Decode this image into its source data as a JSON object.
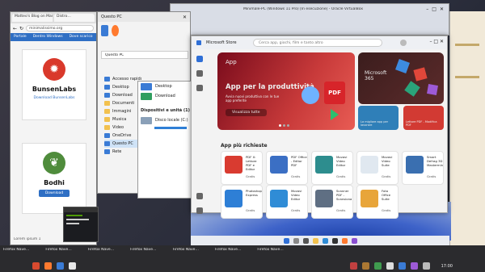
{
  "top_window": {
    "title": "Minimale-PC (Windows 11 Pro) [In esecuzione] - Oracle VirtualBox"
  },
  "browser": {
    "tab1": "Matteo's Blog on Mastodon",
    "tab2": "Distro…",
    "url": "minimalissimo.org",
    "nav": [
      "Portale",
      "Dentro Windows",
      "Dove scarico"
    ],
    "distros": [
      {
        "name": "BunsenLabs",
        "link": "Download BunsenLabs",
        "color": "#d9392b",
        "glyph": "✹"
      },
      {
        "name": "Bodhi",
        "link": "",
        "color": "#4f8c3c",
        "glyph": "❦",
        "button": "Download"
      }
    ],
    "status": "Lorem ipsum 1"
  },
  "explorer": {
    "title": "Questo PC",
    "address": "Questo PC",
    "sidebar": [
      "Accesso rapido",
      "Desktop",
      "Download",
      "Documenti",
      "Immagini",
      "Musica",
      "Video",
      "OneDrive",
      "Questo PC",
      "Rete"
    ],
    "items": [
      "Desktop",
      "Download"
    ],
    "drives_header": "Dispositivi e unità (1)",
    "drive": "Disco locale (C:)"
  },
  "settings_panel": {
    "header": "Dispositivi e unità (1)",
    "rows": [
      "Disco locale (C:)"
    ]
  },
  "store": {
    "title": "Microsoft Store",
    "search_placeholder": "Cerca app, giochi, film e tanto altro",
    "hero": {
      "tag": "App",
      "title": "App per la produttività",
      "subtitle": "Avvia nuovi produttivo con le tue app preferite",
      "button": "Visualizza tutte"
    },
    "hero2": {
      "title": "Microsoft 365"
    },
    "mini_cards": [
      {
        "label": "La migliore app per lavorare",
        "color": "#2f7fb8"
      },
      {
        "label": "Lettore PDF - Modifica PDF",
        "color": "#d23a33"
      }
    ],
    "section_title": "App più richieste",
    "apps": [
      {
        "name": "PDF X: Lettore PDF e Editor",
        "price": "Gratis",
        "color": "#d93b30"
      },
      {
        "name": "PDF Office - Editor PDF",
        "price": "Gratis",
        "color": "#3b6fc4"
      },
      {
        "name": "Movavi Video Editor",
        "price": "Gratis",
        "color": "#2d8d8e"
      },
      {
        "name": "Movavi Video Suite",
        "price": "Gratis",
        "color": "#e0e8f0"
      },
      {
        "name": "Smart Defrag 3D Mastermind",
        "price": "Gratis",
        "color": "#3a6fb0"
      },
      {
        "name": "Photoshop Express",
        "price": "Gratis",
        "color": "#2e7fd6"
      },
      {
        "name": "Movavi Video Editor",
        "price": "Gratis",
        "color": "#2f8cd6"
      },
      {
        "name": "Scanner PDF - Scansiona",
        "price": "Gratis",
        "color": "#5f6f83"
      },
      {
        "name": "Foto Office Suite",
        "price": "Gratis",
        "color": "#e8a53a"
      }
    ],
    "nav": [
      "Home",
      "App",
      "Giochi",
      "Raccolta",
      "Guida"
    ]
  },
  "panel": {
    "tasks": [
      "Firefox Nave…",
      "Firefox Nave…",
      "Firefox Nave…",
      "Firefox Nave…",
      "Firefox Nave…",
      "Firefox Nave…",
      "Firefox Nave…"
    ],
    "clock": "17:00"
  }
}
